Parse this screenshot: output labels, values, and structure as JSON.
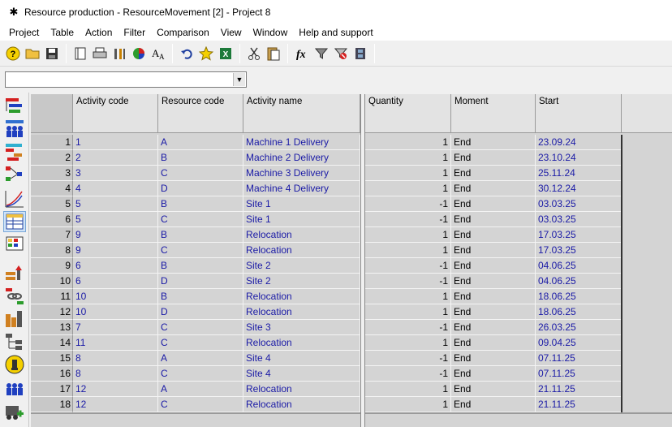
{
  "window": {
    "title": "Resource production - ResourceMovement [2] - Project 8"
  },
  "menu": [
    "Project",
    "Table",
    "Action",
    "Filter",
    "Comparison",
    "View",
    "Window",
    "Help and support"
  ],
  "filter": {
    "value": ""
  },
  "table": {
    "left_headers": [
      "Activity code",
      "Resource code",
      "Activity name"
    ],
    "right_headers": [
      "Quantity",
      "Moment",
      "Start"
    ],
    "rows": [
      {
        "n": "1",
        "code": "1",
        "res": "A",
        "name": "Machine 1 Delivery",
        "qty": "1",
        "moment": "End",
        "start": "23.09.24"
      },
      {
        "n": "2",
        "code": "2",
        "res": "B",
        "name": "Machine 2 Delivery",
        "qty": "1",
        "moment": "End",
        "start": "23.10.24"
      },
      {
        "n": "3",
        "code": "3",
        "res": "C",
        "name": "Machine 3 Delivery",
        "qty": "1",
        "moment": "End",
        "start": "25.11.24"
      },
      {
        "n": "4",
        "code": "4",
        "res": "D",
        "name": "Machine 4 Delivery",
        "qty": "1",
        "moment": "End",
        "start": "30.12.24"
      },
      {
        "n": "5",
        "code": "5",
        "res": "B",
        "name": "Site 1",
        "qty": "-1",
        "moment": "End",
        "start": "03.03.25"
      },
      {
        "n": "6",
        "code": "5",
        "res": "C",
        "name": "Site 1",
        "qty": "-1",
        "moment": "End",
        "start": "03.03.25"
      },
      {
        "n": "7",
        "code": "9",
        "res": "B",
        "name": "Relocation",
        "qty": "1",
        "moment": "End",
        "start": "17.03.25"
      },
      {
        "n": "8",
        "code": "9",
        "res": "C",
        "name": "Relocation",
        "qty": "1",
        "moment": "End",
        "start": "17.03.25"
      },
      {
        "n": "9",
        "code": "6",
        "res": "B",
        "name": "Site 2",
        "qty": "-1",
        "moment": "End",
        "start": "04.06.25"
      },
      {
        "n": "10",
        "code": "6",
        "res": "D",
        "name": "Site 2",
        "qty": "-1",
        "moment": "End",
        "start": "04.06.25"
      },
      {
        "n": "11",
        "code": "10",
        "res": "B",
        "name": "Relocation",
        "qty": "1",
        "moment": "End",
        "start": "18.06.25"
      },
      {
        "n": "12",
        "code": "10",
        "res": "D",
        "name": "Relocation",
        "qty": "1",
        "moment": "End",
        "start": "18.06.25"
      },
      {
        "n": "13",
        "code": "7",
        "res": "C",
        "name": "Site 3",
        "qty": "-1",
        "moment": "End",
        "start": "26.03.25"
      },
      {
        "n": "14",
        "code": "11",
        "res": "C",
        "name": "Relocation",
        "qty": "1",
        "moment": "End",
        "start": "09.04.25"
      },
      {
        "n": "15",
        "code": "8",
        "res": "A",
        "name": "Site 4",
        "qty": "-1",
        "moment": "End",
        "start": "07.11.25"
      },
      {
        "n": "16",
        "code": "8",
        "res": "C",
        "name": "Site 4",
        "qty": "-1",
        "moment": "End",
        "start": "07.11.25"
      },
      {
        "n": "17",
        "code": "12",
        "res": "A",
        "name": "Relocation",
        "qty": "1",
        "moment": "End",
        "start": "21.11.25"
      },
      {
        "n": "18",
        "code": "12",
        "res": "C",
        "name": "Relocation",
        "qty": "1",
        "moment": "End",
        "start": "21.11.25"
      }
    ]
  },
  "toolbar_icons": [
    "help-icon",
    "open-folder-icon",
    "save-icon",
    "book-icon",
    "print-icon",
    "tools-icon",
    "pie-chart-icon",
    "font-size-icon",
    "undo-icon",
    "star-icon",
    "excel-icon",
    "cut-icon",
    "paste-icon",
    "function-icon",
    "filter-icon",
    "clear-filter-icon",
    "film-icon"
  ],
  "sidebar_icons": [
    "structure-tree-icon",
    "resources-team-icon",
    "bar-chart-icon",
    "network-diagram-icon",
    "s-curve-chart-icon",
    "table-view-icon",
    "grid-view-icon",
    "resource-assign-icon",
    "link-icon",
    "histogram-icon",
    "hierarchy-icon",
    "bulb-icon",
    "team-icon",
    "add-resource-icon"
  ],
  "colors": {
    "accent_text": "#1a1aa6",
    "grid_bg": "#d4d4d4"
  }
}
